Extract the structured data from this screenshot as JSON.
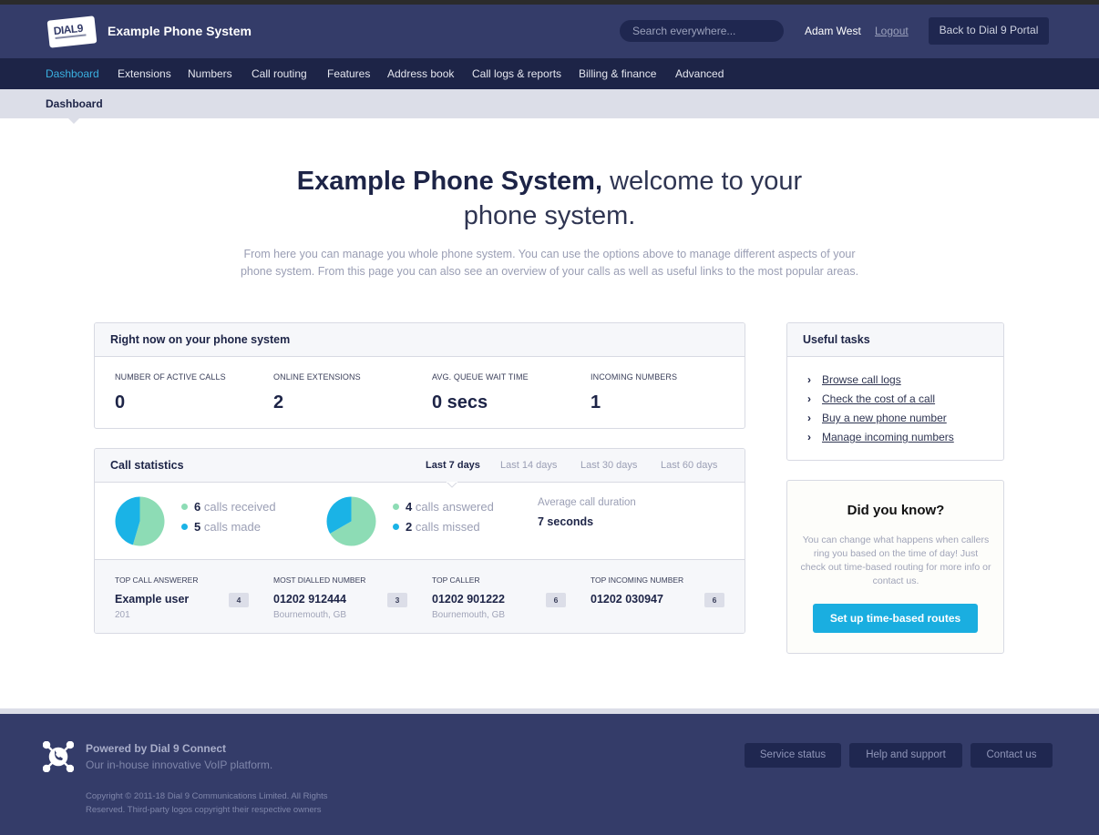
{
  "header": {
    "logo_text": "DIAL9",
    "app_title": "Example Phone System",
    "search_placeholder": "Search everywhere...",
    "username": "Adam West",
    "logout_label": "Logout",
    "portal_button": "Back to Dial 9 Portal"
  },
  "nav": {
    "items": [
      {
        "label": "Dashboard",
        "active": true
      },
      {
        "label": "Extensions"
      },
      {
        "label": "Numbers"
      },
      {
        "label": "Call routing"
      },
      {
        "label": "Features"
      },
      {
        "label": "Address book"
      },
      {
        "label": "Call logs & reports"
      },
      {
        "label": "Billing & finance"
      },
      {
        "label": "Advanced"
      }
    ]
  },
  "subnav": {
    "current": "Dashboard"
  },
  "hero": {
    "title_bold": "Example Phone System,",
    "title_light": " welcome to your phone system.",
    "description": "From here you can manage you whole phone system. You can use the options above to manage different aspects of your phone system. From this page you can also see an overview of your calls as well as useful links to the most popular areas."
  },
  "right_now": {
    "title": "Right now on your phone system",
    "stats": [
      {
        "label": "Number of active calls",
        "value": "0"
      },
      {
        "label": "Online extensions",
        "value": "2"
      },
      {
        "label": "Avg. queue wait time",
        "value": "0 secs"
      },
      {
        "label": "Incoming numbers",
        "value": "1"
      }
    ]
  },
  "call_stats": {
    "title": "Call statistics",
    "ranges": [
      {
        "label": "Last 7 days",
        "active": true
      },
      {
        "label": "Last 14 days"
      },
      {
        "label": "Last 30 days"
      },
      {
        "label": "Last 60 days"
      }
    ],
    "colors": {
      "primary": "#8ddcb5",
      "secondary": "#1ab3e6"
    },
    "pie1": {
      "items": [
        {
          "count": "6",
          "label": "calls received",
          "value": 6
        },
        {
          "count": "5",
          "label": "calls made",
          "value": 5
        }
      ]
    },
    "pie2": {
      "items": [
        {
          "count": "4",
          "label": "calls answered",
          "value": 4
        },
        {
          "count": "2",
          "label": "calls missed",
          "value": 2
        }
      ]
    },
    "avg_duration_label": "Average call duration",
    "avg_duration_value": "7 seconds",
    "tops": [
      {
        "label": "Top call answerer",
        "value": "Example user",
        "sub": "201",
        "badge": "4"
      },
      {
        "label": "Most dialled number",
        "value": "01202 912444",
        "sub": "Bournemouth, GB",
        "badge": "3"
      },
      {
        "label": "Top caller",
        "value": "01202 901222",
        "sub": "Bournemouth, GB",
        "badge": "6"
      },
      {
        "label": "Top incoming number",
        "value": "01202 030947",
        "sub": "",
        "badge": "6"
      }
    ]
  },
  "useful_tasks": {
    "title": "Useful tasks",
    "items": [
      "Browse call logs",
      "Check the cost of a call",
      "Buy a new phone number",
      "Manage incoming numbers"
    ]
  },
  "did_you_know": {
    "title": "Did you know?",
    "text": "You can change what happens when callers ring you based on the time of day! Just check out time-based routing for more info or contact us.",
    "button": "Set up time-based routes"
  },
  "footer": {
    "powered_by": "Powered by Dial 9 Connect",
    "tagline": "Our in-house innovative VoIP platform.",
    "copyright": "Copyright © 2011-18 Dial 9 Communications Limited. All Rights Reserved. Third-party logos copyright their respective owners",
    "buttons": [
      "Service status",
      "Help and support",
      "Contact us"
    ]
  }
}
